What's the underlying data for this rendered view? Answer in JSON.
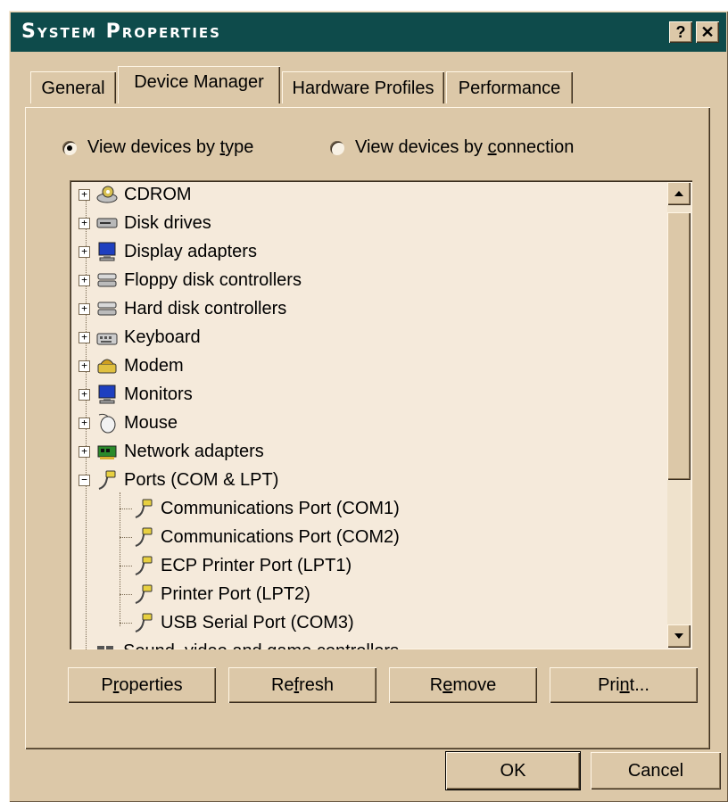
{
  "window": {
    "title": "System Properties",
    "help_label": "?",
    "close_label": "✕"
  },
  "tabs": [
    {
      "label": "General",
      "active": false
    },
    {
      "label": "Device Manager",
      "active": true
    },
    {
      "label": "Hardware Profiles",
      "active": false
    },
    {
      "label": "Performance",
      "active": false
    }
  ],
  "view_options": {
    "by_type": {
      "pre": "View devices by ",
      "key": "t",
      "post": "ype",
      "selected": true
    },
    "by_connection": {
      "pre": "View devices by ",
      "key": "c",
      "post": "onnection",
      "selected": false
    }
  },
  "device_tree": {
    "categories": [
      {
        "label": "CDROM",
        "icon": "cdrom-icon",
        "expander": "+"
      },
      {
        "label": "Disk drives",
        "icon": "disk-drive-icon",
        "expander": "+"
      },
      {
        "label": "Display adapters",
        "icon": "display-adapter-icon",
        "expander": "+"
      },
      {
        "label": "Floppy disk controllers",
        "icon": "floppy-controller-icon",
        "expander": "+"
      },
      {
        "label": "Hard disk controllers",
        "icon": "hard-disk-controller-icon",
        "expander": "+"
      },
      {
        "label": "Keyboard",
        "icon": "keyboard-icon",
        "expander": "+"
      },
      {
        "label": "Modem",
        "icon": "modem-icon",
        "expander": "+"
      },
      {
        "label": "Monitors",
        "icon": "monitor-icon",
        "expander": "+"
      },
      {
        "label": "Mouse",
        "icon": "mouse-icon",
        "expander": "+"
      },
      {
        "label": "Network adapters",
        "icon": "network-adapter-icon",
        "expander": "+"
      },
      {
        "label": "Ports (COM & LPT)",
        "icon": "port-icon",
        "expander": "−"
      }
    ],
    "ports_children": [
      {
        "label": "Communications Port (COM1)",
        "icon": "port-icon"
      },
      {
        "label": "Communications Port (COM2)",
        "icon": "port-icon"
      },
      {
        "label": "ECP Printer Port (LPT1)",
        "icon": "port-icon"
      },
      {
        "label": "Printer Port (LPT2)",
        "icon": "port-icon"
      },
      {
        "label": "USB Serial Port (COM3)",
        "icon": "port-icon"
      }
    ],
    "partial_row": {
      "label": "Sound, video and game controllers",
      "icon": "sound-icon"
    }
  },
  "actions": {
    "properties": {
      "pre": "P",
      "key": "r",
      "post": "operties"
    },
    "refresh": {
      "pre": "Re",
      "key": "f",
      "post": "resh"
    },
    "remove": {
      "pre": "R",
      "key": "e",
      "post": "move"
    },
    "print": {
      "pre": "Pri",
      "key": "n",
      "post": "t..."
    }
  },
  "dialog_buttons": {
    "ok": "OK",
    "cancel": "Cancel"
  },
  "colors": {
    "titlebar": "#0e4b4b",
    "face": "#dcc8a8",
    "listbox_bg": "#f5eadb"
  }
}
